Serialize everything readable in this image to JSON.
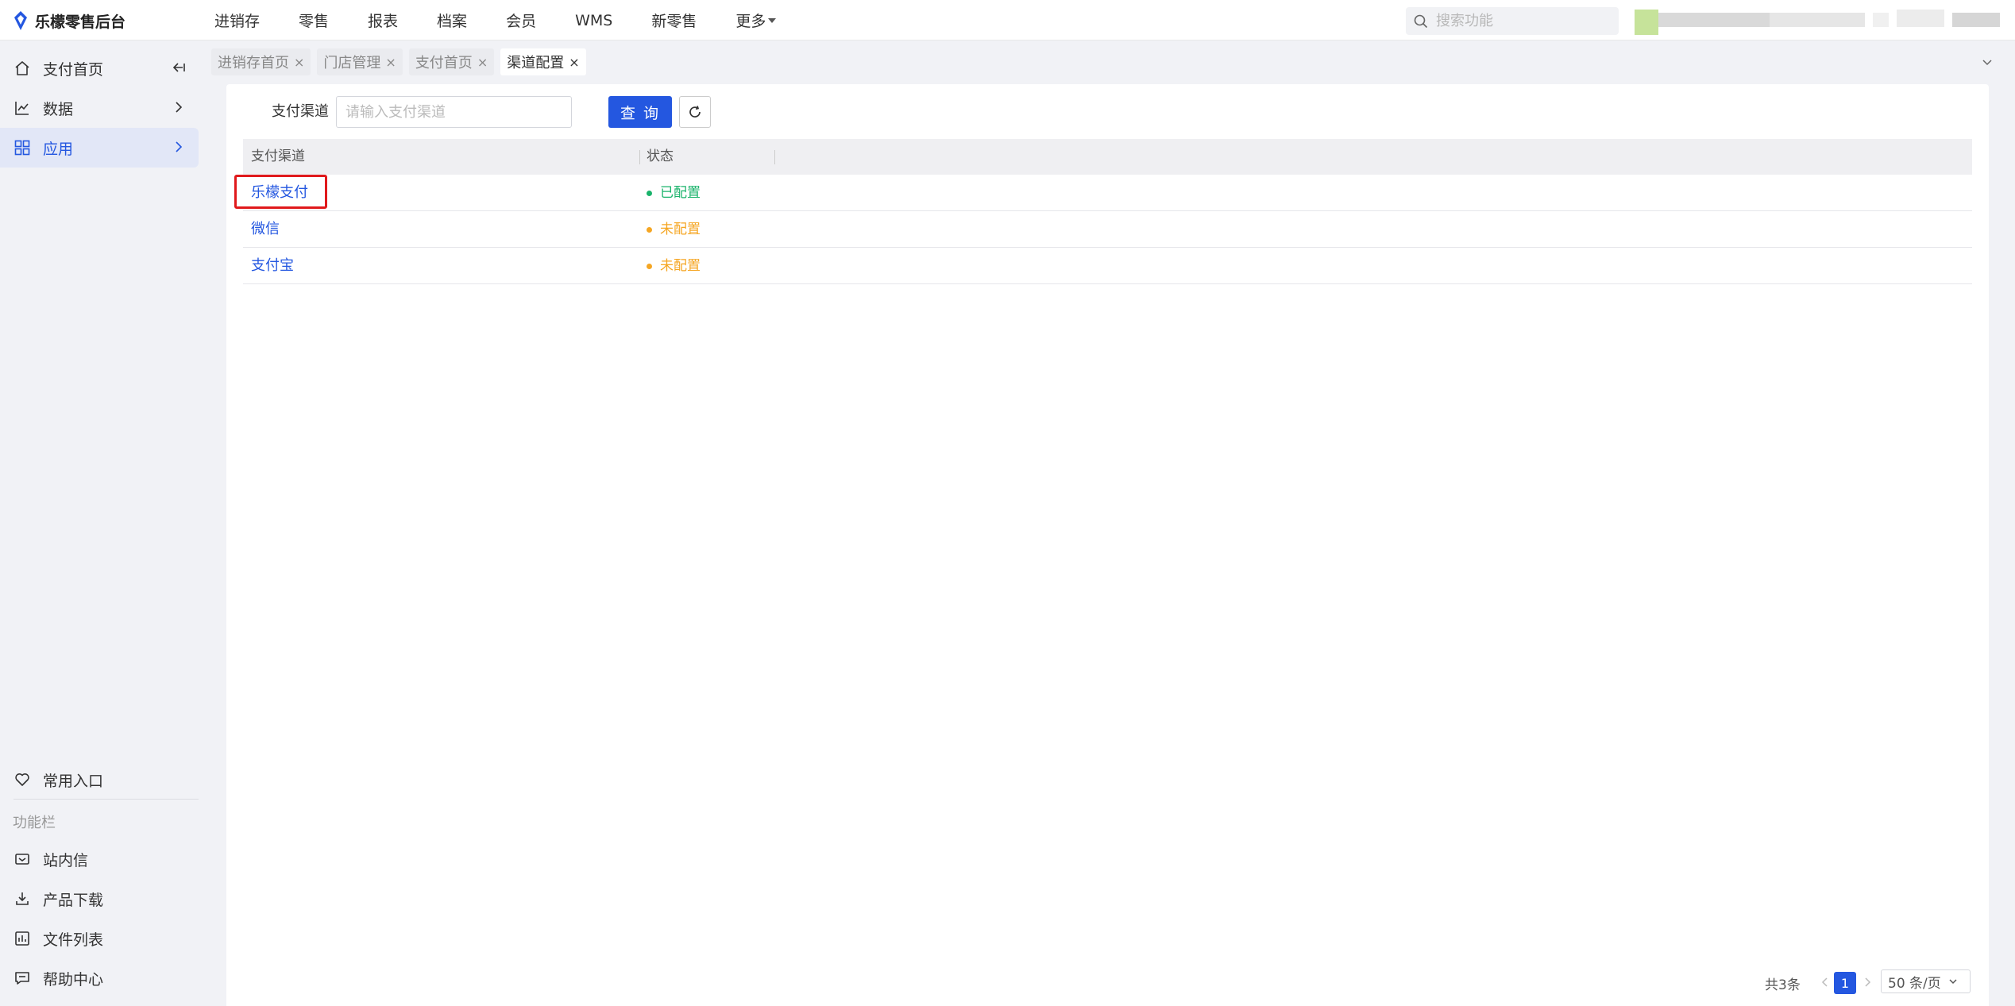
{
  "app": {
    "title": "乐檬零售后台"
  },
  "topnav": {
    "items": [
      "进销存",
      "零售",
      "报表",
      "档案",
      "会员",
      "WMS",
      "新零售",
      "更多"
    ]
  },
  "search": {
    "placeholder": "搜索功能"
  },
  "sidebar": {
    "items": [
      {
        "label": "支付首页",
        "icon": "home-icon"
      },
      {
        "label": "数据",
        "icon": "chart-line-icon"
      },
      {
        "label": "应用",
        "icon": "grid-icon"
      }
    ],
    "favorites_label": "常用入口",
    "section_title": "功能栏",
    "tools": [
      {
        "label": "站内信",
        "icon": "mail-icon"
      },
      {
        "label": "产品下载",
        "icon": "download-icon"
      },
      {
        "label": "文件列表",
        "icon": "file-list-icon"
      },
      {
        "label": "帮助中心",
        "icon": "help-icon"
      }
    ]
  },
  "tabs": [
    {
      "label": "进销存首页",
      "active": false
    },
    {
      "label": "门店管理",
      "active": false
    },
    {
      "label": "支付首页",
      "active": false
    },
    {
      "label": "渠道配置",
      "active": true
    }
  ],
  "filter": {
    "label": "支付渠道",
    "placeholder": "请输入支付渠道",
    "query_label": "查 询"
  },
  "table": {
    "columns": [
      "支付渠道",
      "状态"
    ],
    "rows": [
      {
        "name": "乐檬支付",
        "status": "已配置",
        "status_color": "#1ab36b"
      },
      {
        "name": "微信",
        "status": "未配置",
        "status_color": "#f5a623"
      },
      {
        "name": "支付宝",
        "status": "未配置",
        "status_color": "#f5a623"
      }
    ]
  },
  "pagination": {
    "total": "共3条",
    "current_page": "1",
    "page_size": "50 条/页"
  },
  "colors": {
    "accent": "#2457e0",
    "configured": "#1ab36b",
    "unconfigured": "#f5a623",
    "highlight": "#e0191c"
  }
}
